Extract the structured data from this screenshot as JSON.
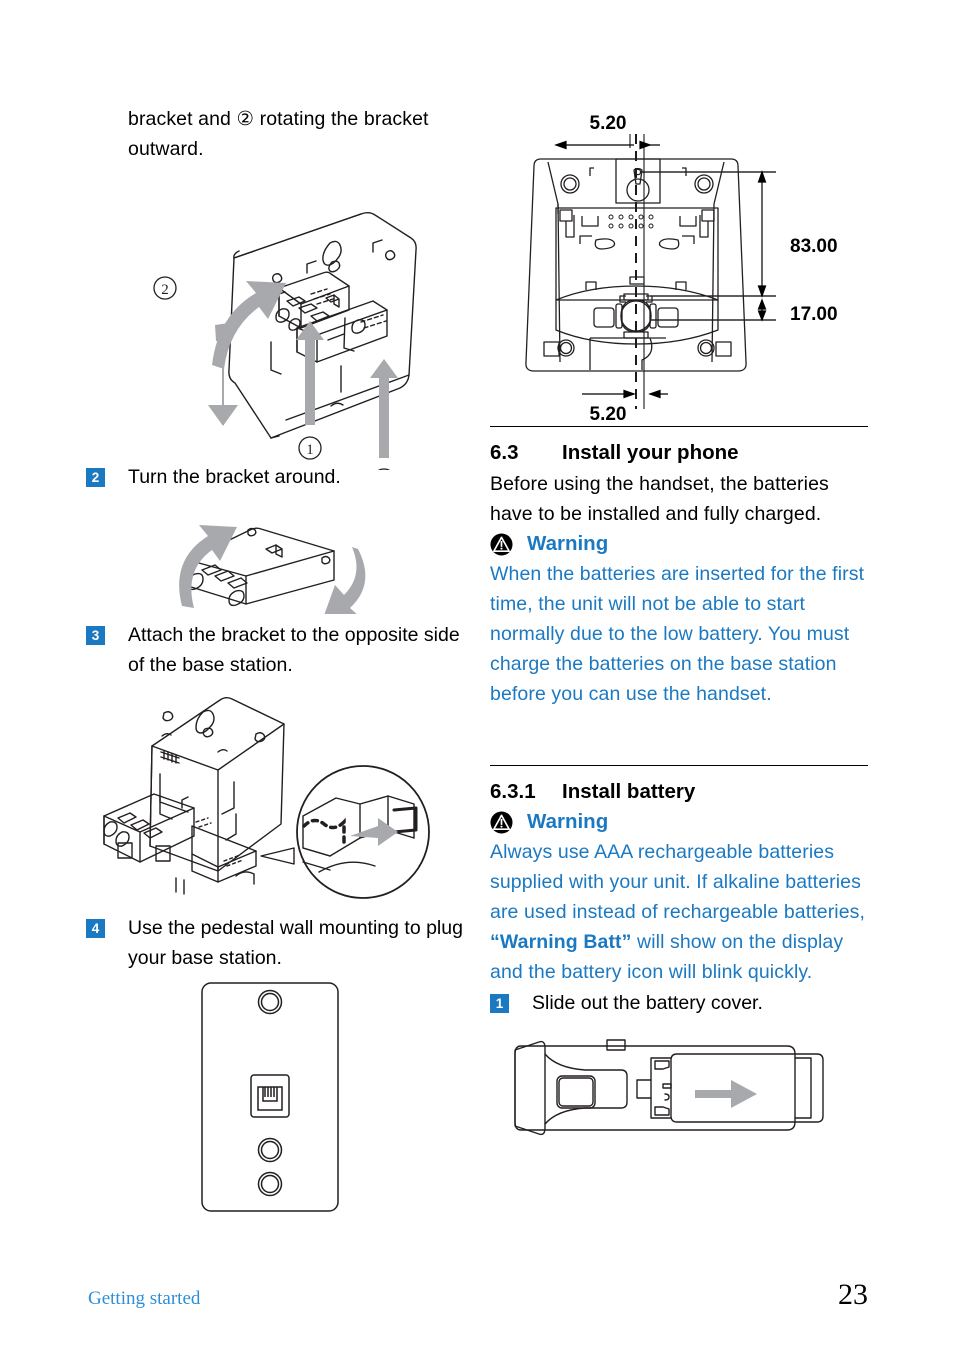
{
  "page": {
    "number": "23",
    "footer_label": "Getting started"
  },
  "left_column": {
    "intro_paragraph": "bracket and ② rotating the bracket outward.",
    "figure_bracket_release": {
      "callout_1a": "①",
      "callout_1b": "①",
      "callout_2": "②"
    },
    "steps": [
      {
        "number": "2",
        "text": "Turn the bracket around."
      },
      {
        "number": "3",
        "text": "Attach the bracket to the opposite side of the base station."
      },
      {
        "number": "4",
        "text": "Use the pedestal wall mounting to plug your base station."
      }
    ]
  },
  "right_column": {
    "dimension_figure": {
      "top_label": "5.20",
      "bottom_label": "5.20",
      "right_label_upper": "83.00",
      "right_label_lower": "17.00"
    },
    "section_6_3": {
      "number": "6.3",
      "title": "Install your phone",
      "intro": "Before using the handset, the batteries have to be installed and fully charged.",
      "warning_label": "Warning",
      "warning_text": "When the batteries are inserted for the first time, the unit will not be able to start normally due to the low battery. You must charge the batteries on the base station before you can use the handset."
    },
    "section_6_3_1": {
      "number": "6.3.1",
      "title": "Install battery",
      "warning_label": "Warning",
      "warning_text_part1": "Always use AAA rechargeable batteries supplied with your unit. If alkaline batteries are used instead of rechargeable batteries, ",
      "warning_text_bold": "“Warning Batt”",
      "warning_text_part2": " will show on the display and the battery icon will blink quickly.",
      "step": {
        "number": "1",
        "text": "Slide out the battery cover."
      }
    }
  },
  "colors": {
    "accent_blue": "#1b79c2",
    "footer_blue": "#2f8fd6",
    "arrow_gray": "#a7a9ac"
  }
}
